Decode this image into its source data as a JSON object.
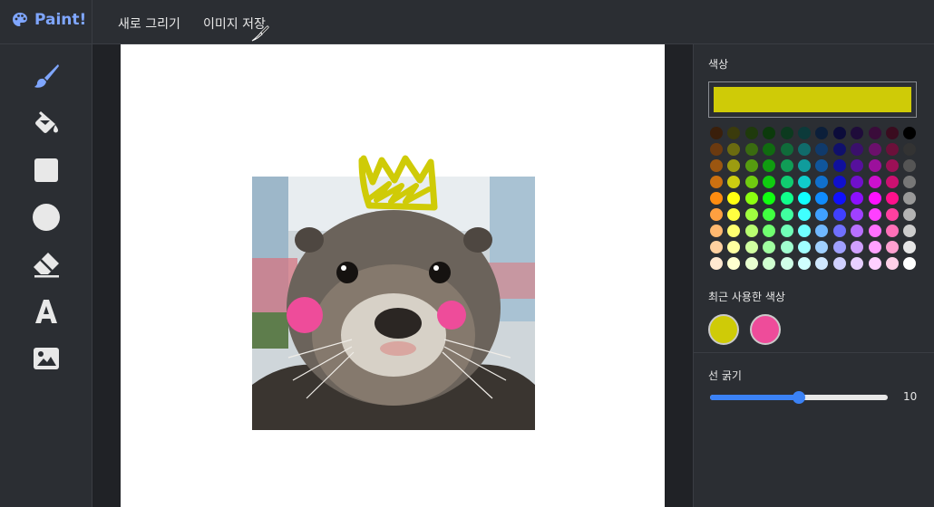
{
  "app": {
    "name": "Paint!"
  },
  "menu": {
    "new_drawing": "새로 그리기",
    "save_image": "이미지 저장"
  },
  "tools": [
    {
      "name": "brush-icon",
      "active": true
    },
    {
      "name": "paint-bucket-icon",
      "active": false
    },
    {
      "name": "rectangle-icon",
      "active": false
    },
    {
      "name": "circle-icon",
      "active": false
    },
    {
      "name": "eraser-icon",
      "active": false
    },
    {
      "name": "text-icon",
      "active": false
    },
    {
      "name": "image-icon",
      "active": false
    }
  ],
  "panel": {
    "color_title": "색상",
    "current_color": "#cfcb07",
    "recent_title": "최근 사용한 색상",
    "recent_colors": [
      "#cfcb07",
      "#ee4c9a"
    ],
    "stroke_title": "선 굵기",
    "stroke_width": 10,
    "stroke_max": 20
  },
  "palette": [
    [
      "#3a1f0b",
      "#3b3b0c",
      "#1f3a0c",
      "#0c3a0c",
      "#0c3a1f",
      "#0c3a3a",
      "#0c1f3a",
      "#0c0c3a",
      "#1f0c3a",
      "#3a0c3a",
      "#3a0c1f",
      "#000000"
    ],
    [
      "#6b3a10",
      "#6b6b10",
      "#3a6b10",
      "#106b10",
      "#106b3a",
      "#106b6b",
      "#103a6b",
      "#10106b",
      "#3a106b",
      "#6b106b",
      "#6b103a",
      "#333333"
    ],
    [
      "#9c5610",
      "#9c9c10",
      "#569c10",
      "#109c10",
      "#109c56",
      "#109c9c",
      "#10569c",
      "#10109c",
      "#56109c",
      "#9c109c",
      "#9c1056",
      "#555555"
    ],
    [
      "#cc7010",
      "#cccc10",
      "#70cc10",
      "#10cc10",
      "#10cc70",
      "#10cccc",
      "#1070cc",
      "#1010cc",
      "#7010cc",
      "#cc10cc",
      "#cc1070",
      "#777777"
    ],
    [
      "#ff8c10",
      "#ffff10",
      "#8cff10",
      "#10ff10",
      "#10ff8c",
      "#10ffff",
      "#108cff",
      "#1010ff",
      "#8c10ff",
      "#ff10ff",
      "#ff108c",
      "#999999"
    ],
    [
      "#ffa040",
      "#ffff40",
      "#a0ff40",
      "#40ff40",
      "#40ffa0",
      "#40ffff",
      "#40a0ff",
      "#4040ff",
      "#a040ff",
      "#ff40ff",
      "#ff40a0",
      "#b3b3b3"
    ],
    [
      "#ffb870",
      "#ffff70",
      "#b8ff70",
      "#70ff70",
      "#70ffb8",
      "#70ffff",
      "#70b8ff",
      "#7070ff",
      "#b870ff",
      "#ff70ff",
      "#ff70b8",
      "#cccccc"
    ],
    [
      "#ffd0a0",
      "#ffffa0",
      "#d0ffa0",
      "#a0ffa0",
      "#a0ffd0",
      "#a0ffff",
      "#a0d0ff",
      "#a0a0ff",
      "#d0a0ff",
      "#ffa0ff",
      "#ffa0d0",
      "#e6e6e6"
    ],
    [
      "#ffe8d0",
      "#ffffd0",
      "#e8ffd0",
      "#d0ffd0",
      "#d0ffe8",
      "#d0ffff",
      "#d0e8ff",
      "#d0d0ff",
      "#e8d0ff",
      "#ffd0ff",
      "#ffd0e8",
      "#ffffff"
    ]
  ]
}
